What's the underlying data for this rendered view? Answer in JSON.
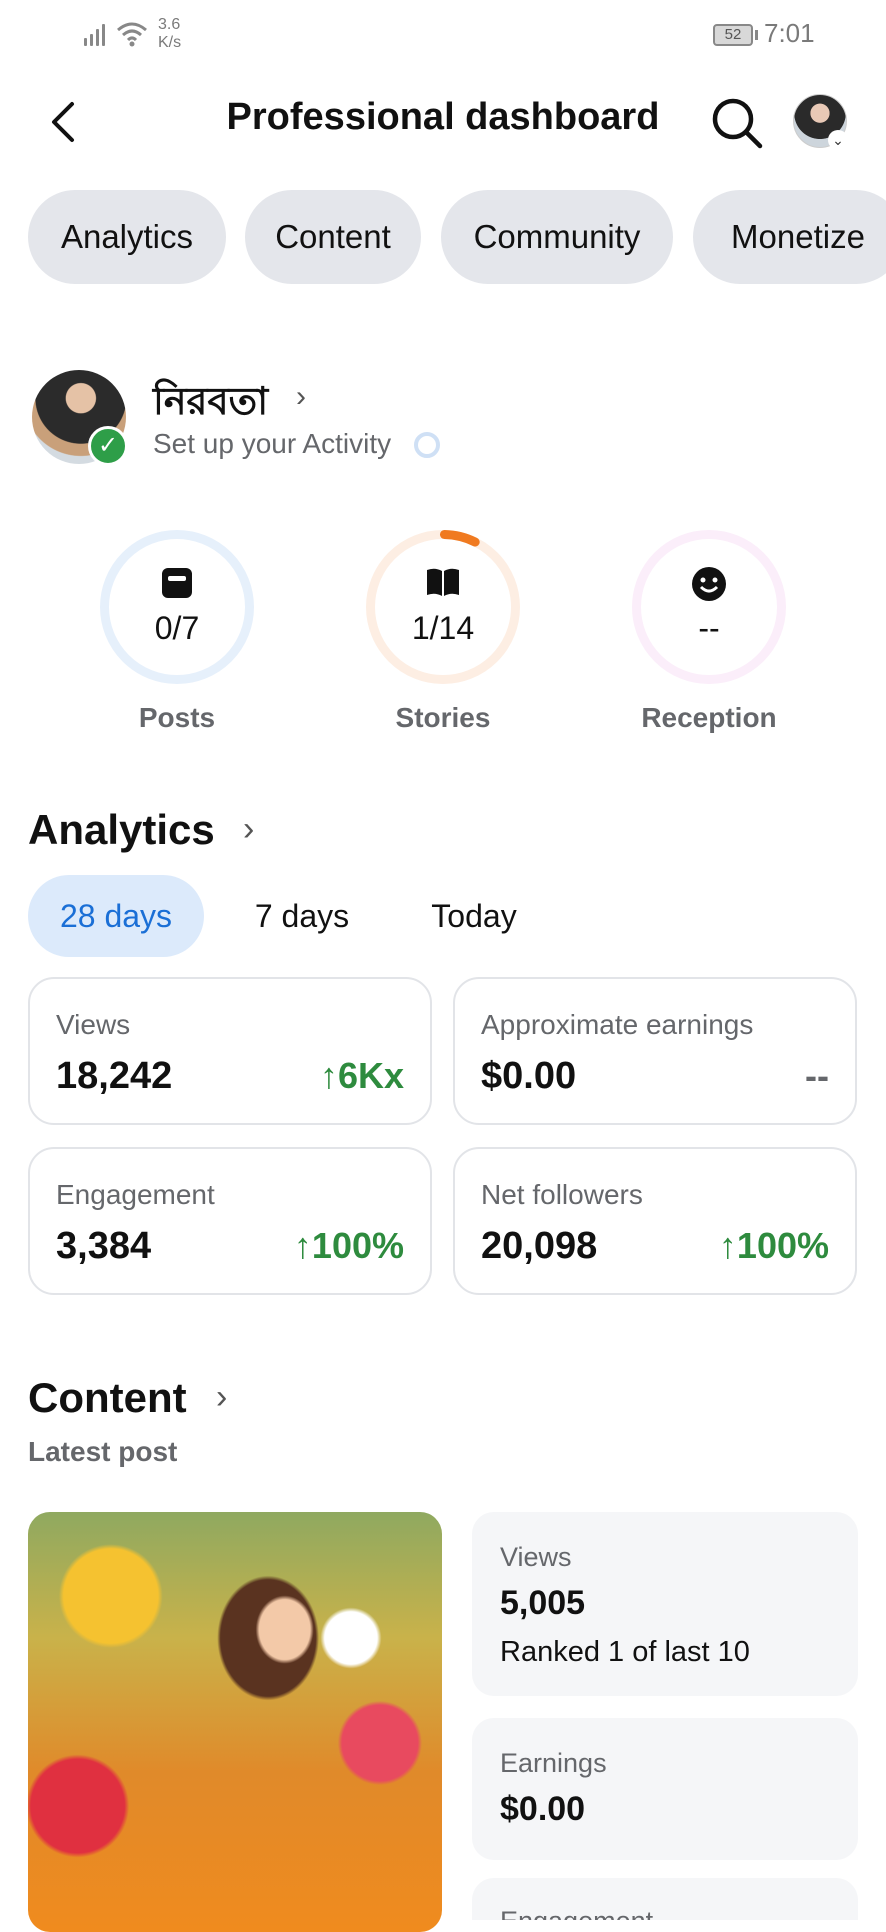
{
  "status_bar": {
    "speed_value": "3.6",
    "speed_unit": "K/s",
    "battery": "52",
    "time": "7:01"
  },
  "header": {
    "title": "Professional dashboard"
  },
  "tabs": [
    "Analytics",
    "Content",
    "Community",
    "Monetize"
  ],
  "profile": {
    "name": "নিরবতা",
    "subtitle": "Set up your Activity"
  },
  "rings": [
    {
      "label": "Posts",
      "value": "0/7",
      "icon": "post-icon",
      "color": "#e6f0fb"
    },
    {
      "label": "Stories",
      "value": "1/14",
      "icon": "book-icon",
      "color": "#fdeee3",
      "progress": 0.07,
      "progress_color": "#f07a20"
    },
    {
      "label": "Reception",
      "value": "--",
      "icon": "smiley-icon",
      "color": "#fbeefa"
    }
  ],
  "analytics": {
    "title": "Analytics",
    "periods": [
      "28 days",
      "7 days",
      "Today"
    ],
    "active_period": "28 days",
    "cards": [
      {
        "label": "Views",
        "value": "18,242",
        "change": "6Kx",
        "trend": "up"
      },
      {
        "label": "Approximate earnings",
        "value": "$0.00",
        "change": "--",
        "trend": "none"
      },
      {
        "label": "Engagement",
        "value": "3,384",
        "change": "100%",
        "trend": "up"
      },
      {
        "label": "Net followers",
        "value": "20,098",
        "change": "100%",
        "trend": "up"
      }
    ]
  },
  "content": {
    "title": "Content",
    "subtitle": "Latest post",
    "stats": [
      {
        "label": "Views",
        "value": "5,005",
        "note": "Ranked 1 of last 10"
      },
      {
        "label": "Earnings",
        "value": "$0.00"
      },
      {
        "label": "Engagement"
      }
    ]
  },
  "colors": {
    "accent": "#1a6fd6",
    "positive": "#2e8b3e",
    "verified": "#2e9e48"
  }
}
